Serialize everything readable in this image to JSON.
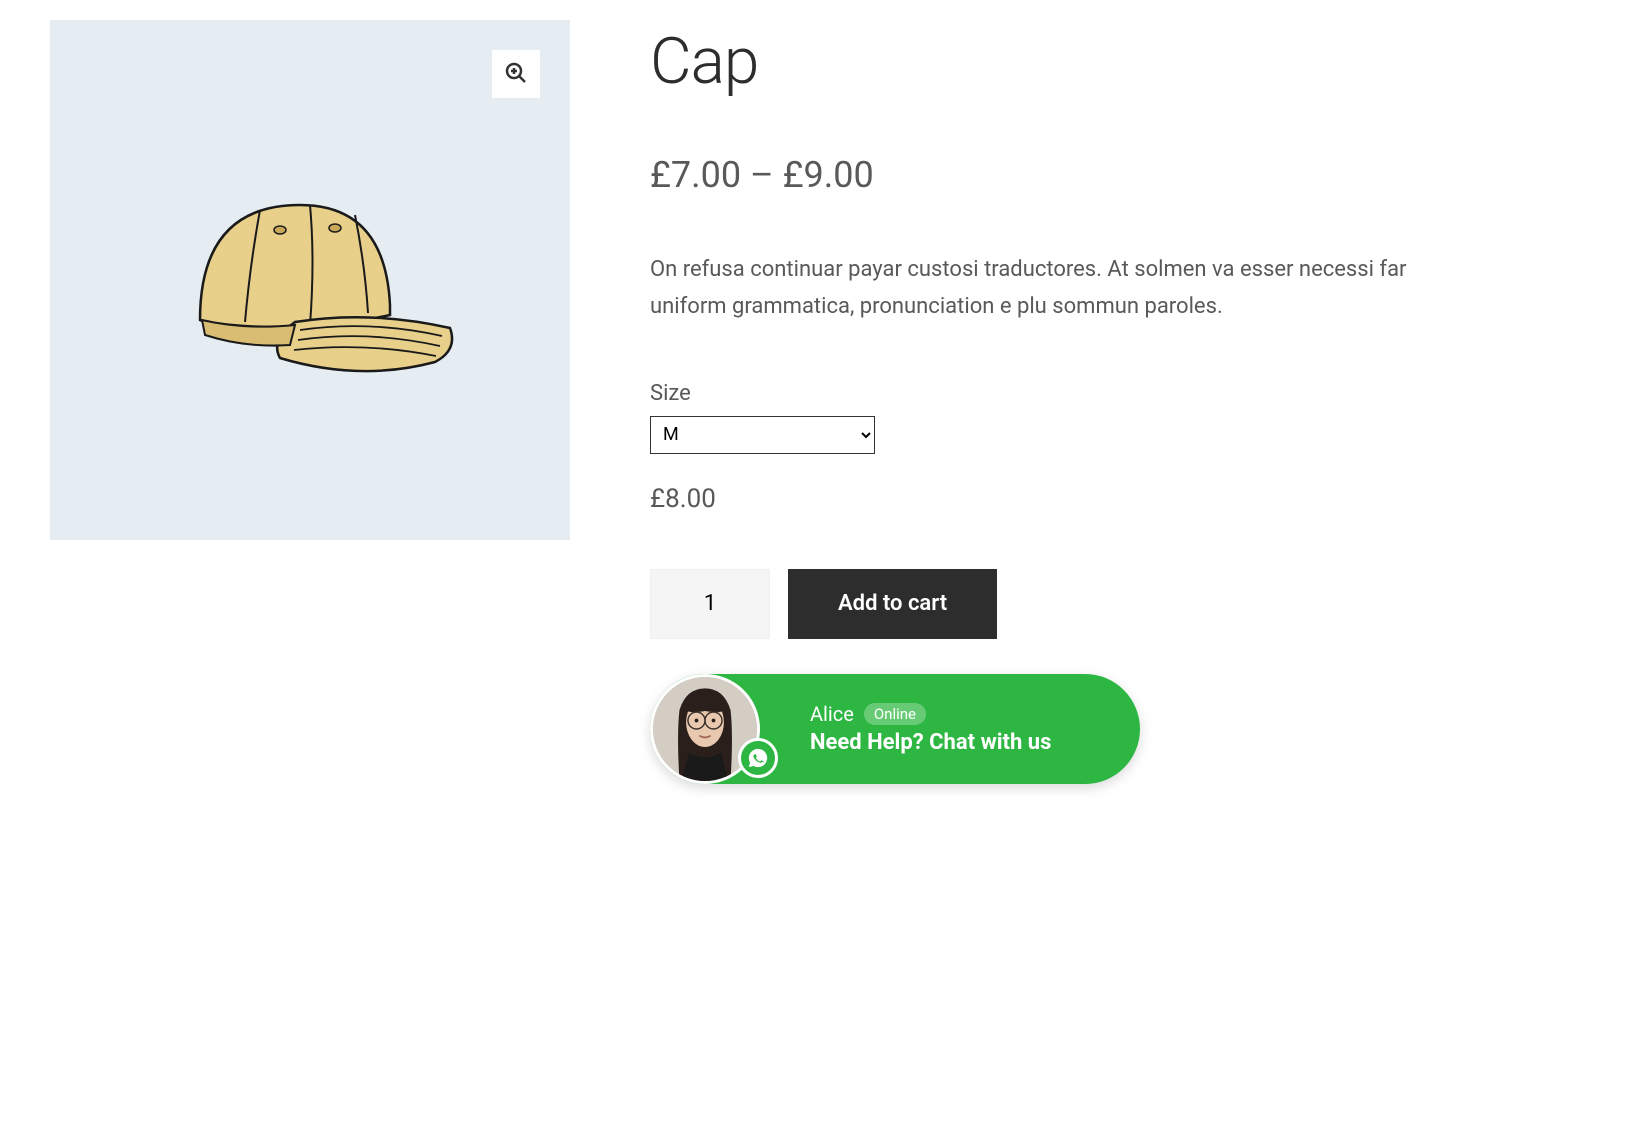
{
  "product": {
    "title": "Cap",
    "price_range": "£7.00 – £9.00",
    "description": "On refusa continuar payar custosi traductores. At solmen va esser necessi far uniform grammatica, pronunciation e plu sommun paroles.",
    "size_label": "Size",
    "size_value": "M",
    "variant_price": "£8.00",
    "quantity": "1",
    "add_to_cart_label": "Add to cart"
  },
  "chat": {
    "agent_name": "Alice",
    "status": "Online",
    "prompt": "Need Help? Chat with us"
  }
}
